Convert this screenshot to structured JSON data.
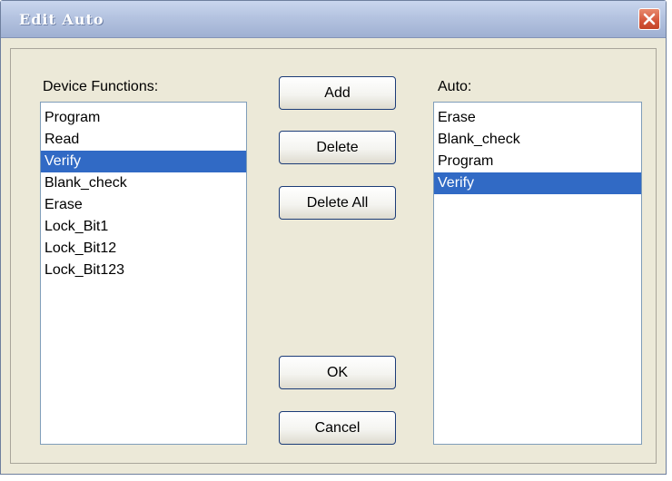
{
  "window": {
    "title": "Edit Auto"
  },
  "device_functions": {
    "label": "Device Functions:",
    "items": [
      "Program",
      "Read",
      "Verify",
      "Blank_check",
      "Erase",
      "Lock_Bit1",
      "Lock_Bit12",
      "Lock_Bit123"
    ],
    "selected": "Verify"
  },
  "auto": {
    "label": "Auto:",
    "items": [
      "Erase",
      "Blank_check",
      "Program",
      "Verify"
    ],
    "selected": "Verify"
  },
  "buttons": {
    "add": "Add",
    "delete": "Delete",
    "delete_all": "Delete All",
    "ok": "OK",
    "cancel": "Cancel"
  },
  "icons": {
    "close": "close-icon"
  },
  "colors": {
    "selection": "#316ac5",
    "close_button": "#d4553a",
    "dialog_bg": "#ece9d8"
  }
}
